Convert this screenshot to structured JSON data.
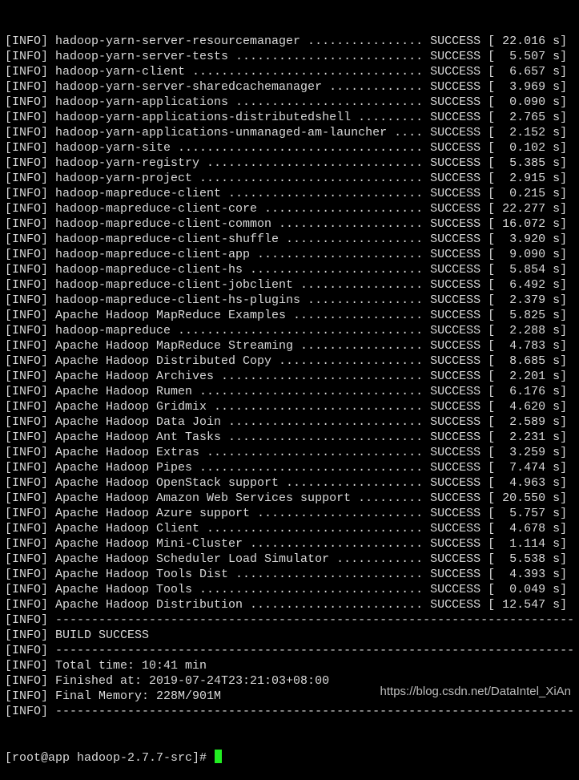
{
  "terminal": {
    "lines": [
      "[INFO] hadoop-yarn-server-resourcemanager ................ SUCCESS [ 22.016 s]",
      "[INFO] hadoop-yarn-server-tests .......................... SUCCESS [  5.507 s]",
      "[INFO] hadoop-yarn-client ................................ SUCCESS [  6.657 s]",
      "[INFO] hadoop-yarn-server-sharedcachemanager ............. SUCCESS [  3.969 s]",
      "[INFO] hadoop-yarn-applications .......................... SUCCESS [  0.090 s]",
      "[INFO] hadoop-yarn-applications-distributedshell ......... SUCCESS [  2.765 s]",
      "[INFO] hadoop-yarn-applications-unmanaged-am-launcher .... SUCCESS [  2.152 s]",
      "[INFO] hadoop-yarn-site .................................. SUCCESS [  0.102 s]",
      "[INFO] hadoop-yarn-registry .............................. SUCCESS [  5.385 s]",
      "[INFO] hadoop-yarn-project ............................... SUCCESS [  2.915 s]",
      "[INFO] hadoop-mapreduce-client ........................... SUCCESS [  0.215 s]",
      "[INFO] hadoop-mapreduce-client-core ...................... SUCCESS [ 22.277 s]",
      "[INFO] hadoop-mapreduce-client-common .................... SUCCESS [ 16.072 s]",
      "[INFO] hadoop-mapreduce-client-shuffle ................... SUCCESS [  3.920 s]",
      "[INFO] hadoop-mapreduce-client-app ....................... SUCCESS [  9.090 s]",
      "[INFO] hadoop-mapreduce-client-hs ........................ SUCCESS [  5.854 s]",
      "[INFO] hadoop-mapreduce-client-jobclient ................. SUCCESS [  6.492 s]",
      "[INFO] hadoop-mapreduce-client-hs-plugins ................ SUCCESS [  2.379 s]",
      "[INFO] Apache Hadoop MapReduce Examples .................. SUCCESS [  5.825 s]",
      "[INFO] hadoop-mapreduce .................................. SUCCESS [  2.288 s]",
      "[INFO] Apache Hadoop MapReduce Streaming ................. SUCCESS [  4.783 s]",
      "[INFO] Apache Hadoop Distributed Copy .................... SUCCESS [  8.685 s]",
      "[INFO] Apache Hadoop Archives ............................ SUCCESS [  2.201 s]",
      "[INFO] Apache Hadoop Rumen ............................... SUCCESS [  6.176 s]",
      "[INFO] Apache Hadoop Gridmix ............................. SUCCESS [  4.620 s]",
      "[INFO] Apache Hadoop Data Join ........................... SUCCESS [  2.589 s]",
      "[INFO] Apache Hadoop Ant Tasks ........................... SUCCESS [  2.231 s]",
      "[INFO] Apache Hadoop Extras .............................. SUCCESS [  3.259 s]",
      "[INFO] Apache Hadoop Pipes ............................... SUCCESS [  7.474 s]",
      "[INFO] Apache Hadoop OpenStack support ................... SUCCESS [  4.963 s]",
      "[INFO] Apache Hadoop Amazon Web Services support ......... SUCCESS [ 20.550 s]",
      "[INFO] Apache Hadoop Azure support ....................... SUCCESS [  5.757 s]",
      "[INFO] Apache Hadoop Client .............................. SUCCESS [  4.678 s]",
      "[INFO] Apache Hadoop Mini-Cluster ........................ SUCCESS [  1.114 s]",
      "[INFO] Apache Hadoop Scheduler Load Simulator ............ SUCCESS [  5.538 s]",
      "[INFO] Apache Hadoop Tools Dist .......................... SUCCESS [  4.393 s]",
      "[INFO] Apache Hadoop Tools ............................... SUCCESS [  0.049 s]",
      "[INFO] Apache Hadoop Distribution ........................ SUCCESS [ 12.547 s]",
      "[INFO] ------------------------------------------------------------------------",
      "[INFO] BUILD SUCCESS",
      "[INFO] ------------------------------------------------------------------------",
      "[INFO] Total time: 10:41 min",
      "[INFO] Finished at: 2019-07-24T23:21:03+08:00",
      "[INFO] Final Memory: 228M/901M",
      "[INFO] ------------------------------------------------------------------------"
    ],
    "prompt": "[root@app hadoop-2.7.7-src]# ",
    "cursor_color": "#22ee22",
    "text_color": "#d8d8d8",
    "background_color": "#000000"
  },
  "watermark": {
    "text": "https://blog.csdn.net/DataIntel_XiAn"
  }
}
